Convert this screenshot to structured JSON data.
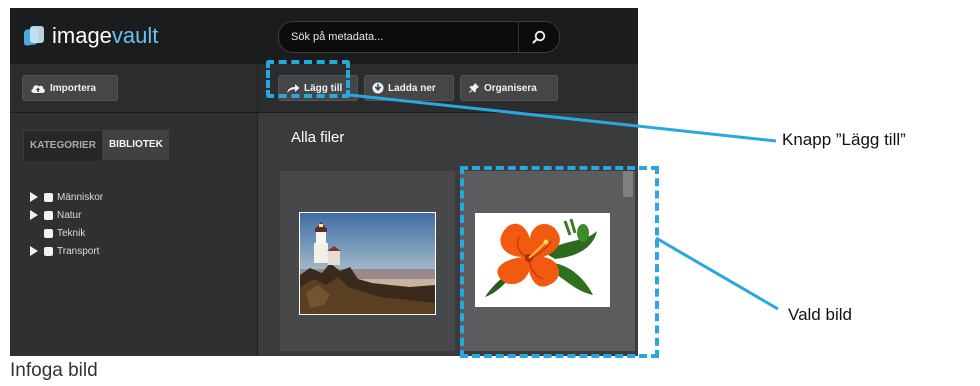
{
  "header": {
    "logo_prefix": "image",
    "logo_suffix": "vault",
    "search_placeholder": "Sök på metadata..."
  },
  "toolbar": {
    "import_label": "Importera",
    "add_label": "Lägg till",
    "download_label": "Ladda ner",
    "organize_label": "Organisera"
  },
  "sidebar": {
    "tabs": [
      "KATEGORIER",
      "BIBLIOTEK"
    ],
    "items": [
      {
        "label": "Människor",
        "expandable": true
      },
      {
        "label": "Natur",
        "expandable": true
      },
      {
        "label": "Teknik",
        "expandable": false
      },
      {
        "label": "Transport",
        "expandable": true
      }
    ]
  },
  "content": {
    "title": "Alla filer"
  },
  "annotations": {
    "add_button_note": "Knapp ”Lägg till”",
    "selected_image_note": "Vald bild"
  },
  "caption": "Infoga bild",
  "colors": {
    "accent_annotation": "#29a7e0",
    "logo_accent": "#6cc0f0"
  }
}
